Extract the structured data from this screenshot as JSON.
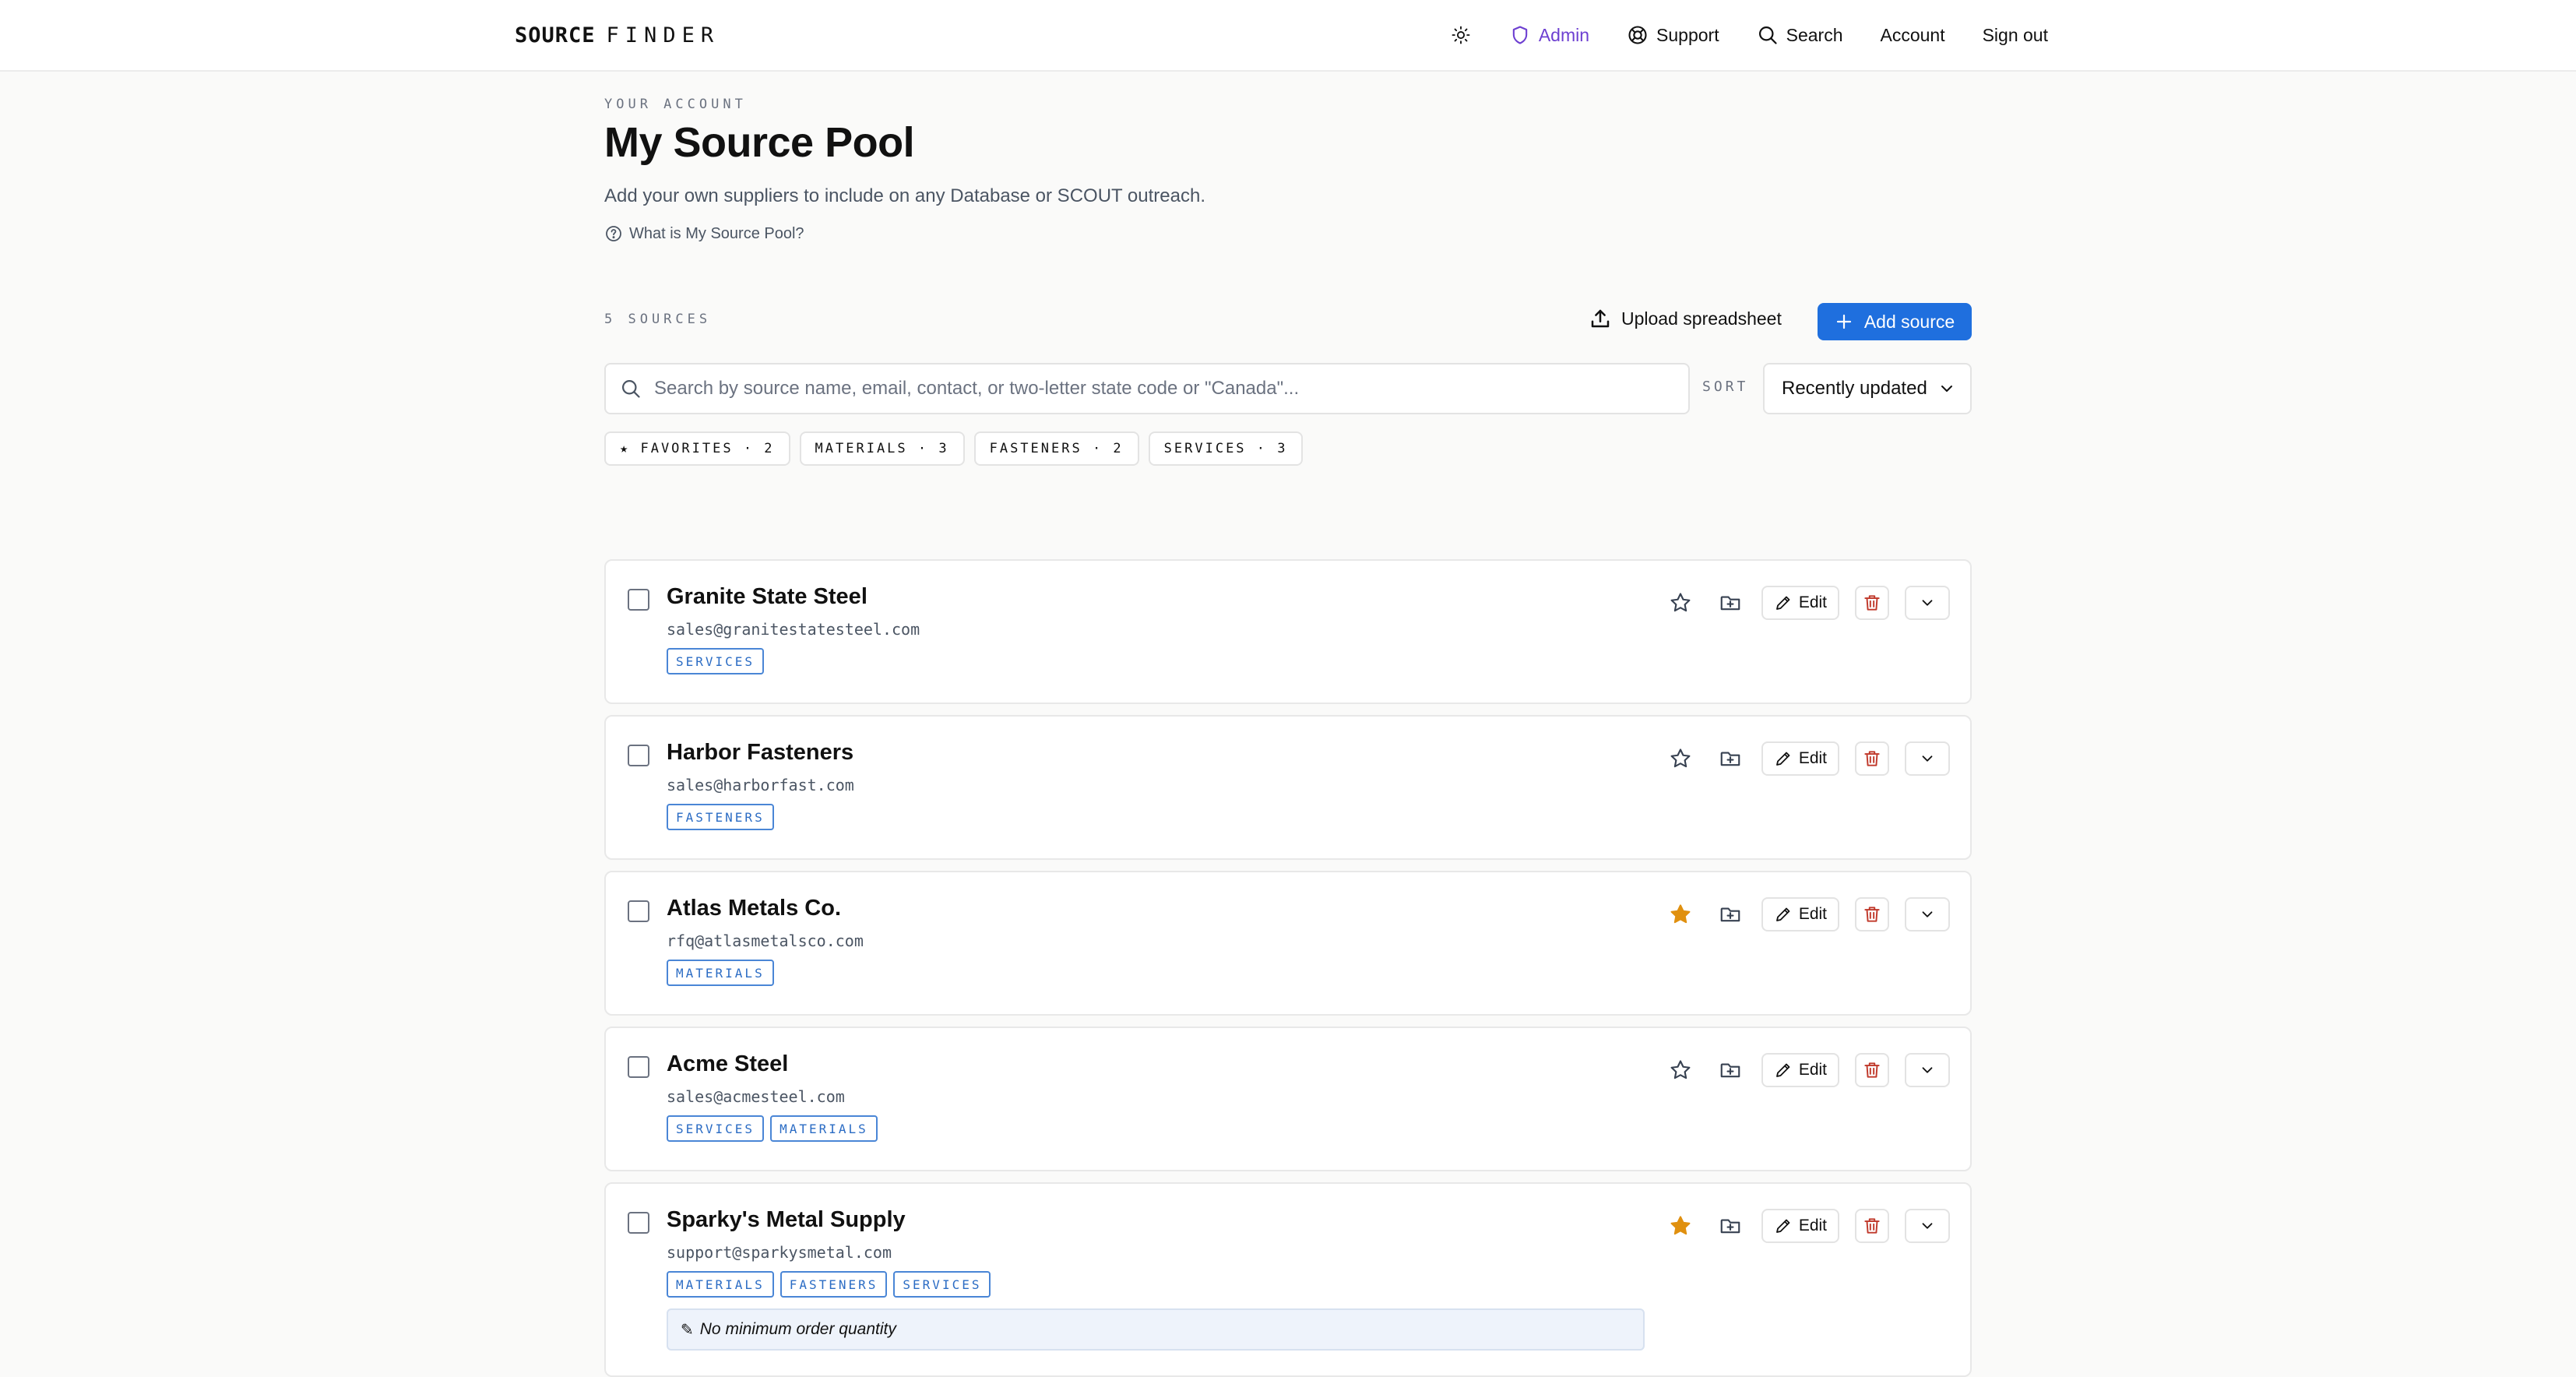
{
  "nav": {
    "brand_bold": "SOURCE",
    "brand_light": "FINDER",
    "admin": "Admin",
    "support": "Support",
    "search": "Search",
    "account": "Account",
    "sign_out": "Sign out"
  },
  "header": {
    "eyebrow": "YOUR ACCOUNT",
    "title": "My Source Pool",
    "subtitle": "Add your own suppliers to include on any Database or SCOUT outreach.",
    "help_link": "What is My Source Pool?"
  },
  "toolbar": {
    "count": "5 SOURCES",
    "upload": "Upload spreadsheet",
    "add": "Add source",
    "search_placeholder": "Search by source name, email, contact, or two-letter state code or \"Canada\"...",
    "sort_label": "SORT",
    "sort_value": "Recently updated"
  },
  "filters": [
    "★ FAVORITES · 2",
    "MATERIALS · 3",
    "FASTENERS · 2",
    "SERVICES · 3"
  ],
  "edit_label": "Edit",
  "sources": [
    {
      "name": "Granite State Steel",
      "email": "sales@granitestatesteel.com",
      "tags": [
        "SERVICES"
      ],
      "favorite": false,
      "note": ""
    },
    {
      "name": "Harbor Fasteners",
      "email": "sales@harborfast.com",
      "tags": [
        "FASTENERS"
      ],
      "favorite": false,
      "note": ""
    },
    {
      "name": "Atlas Metals Co.",
      "email": "rfq@atlasmetalsco.com",
      "tags": [
        "MATERIALS"
      ],
      "favorite": true,
      "note": ""
    },
    {
      "name": "Acme Steel",
      "email": "sales@acmesteel.com",
      "tags": [
        "SERVICES",
        "MATERIALS"
      ],
      "favorite": false,
      "note": ""
    },
    {
      "name": "Sparky's Metal Supply",
      "email": "support@sparkysmetal.com",
      "tags": [
        "MATERIALS",
        "FASTENERS",
        "SERVICES"
      ],
      "favorite": true,
      "note": "No minimum order quantity"
    }
  ],
  "colors": {
    "accent": "#1f6fde",
    "admin": "#6d3fd1",
    "star": "#e0900f",
    "delete": "#c0392b",
    "tag": "#2b6cc4"
  }
}
